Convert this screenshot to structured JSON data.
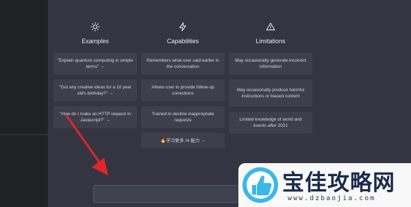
{
  "columns": {
    "examples": {
      "icon": "sun-icon",
      "title": "Examples",
      "items": [
        "\"Explain quantum computing in simple terms\" →",
        "\"Got any creative ideas for a 10 year old's birthday?\" →",
        "\"How do I make an HTTP request in Javascript?\" →"
      ]
    },
    "capabilities": {
      "icon": "lightning-icon",
      "title": "Capabilities",
      "items": [
        "Remembers what user said earlier in the conversation",
        "Allows user to provide follow-up corrections",
        "Trained to decline inappropriate requests"
      ],
      "link": "🔥学习更多 AI 能力 →"
    },
    "limitations": {
      "icon": "warning-icon",
      "title": "Limitations",
      "items": [
        "May occasionally generate incorrect information",
        "May occasionally produce harmful instructions or biased content",
        "Limited knowledge of world and events after 2021"
      ]
    }
  },
  "annotation": {
    "icon": "red-arrow-icon",
    "color": "#e0262a"
  },
  "watermark": {
    "title": "宝佳攻略网",
    "url": "www.dzbaojia.com",
    "icon": "thumbs-up-icon"
  },
  "colors": {
    "background": "#343541",
    "sidebar": "#202123",
    "card": "#3e3f4b",
    "input": "#40414f"
  }
}
